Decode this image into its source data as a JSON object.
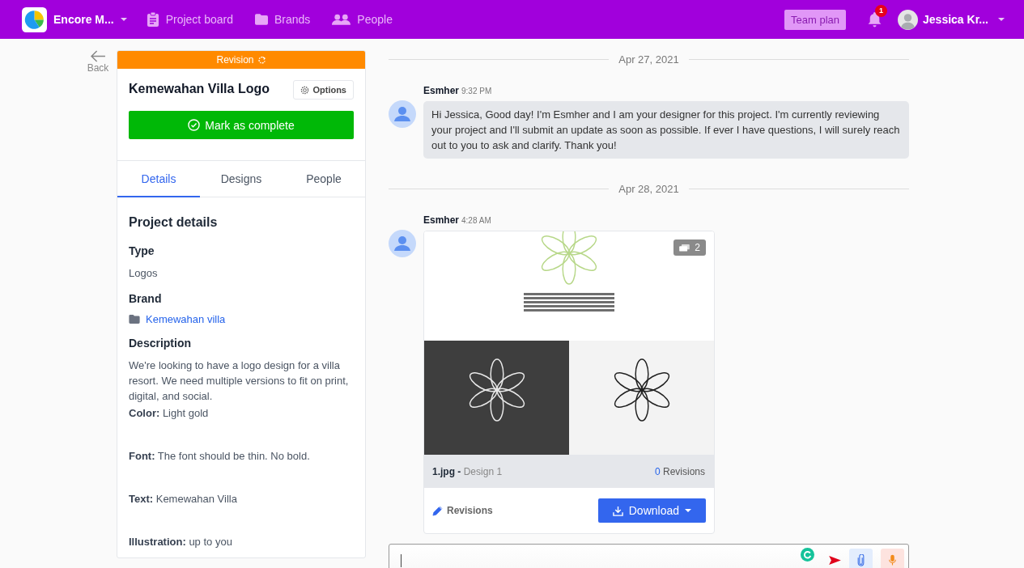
{
  "navbar": {
    "brand": "Encore M...",
    "links": [
      {
        "label": "Project board"
      },
      {
        "label": "Brands"
      },
      {
        "label": "People"
      }
    ],
    "plan": "Team plan",
    "notifications": "1",
    "user": "Jessica Kr..."
  },
  "back": "Back",
  "project": {
    "status": "Revision",
    "title": "Kemewahan Villa Logo",
    "options": "Options",
    "complete": "Mark as complete",
    "tabs": [
      {
        "label": "Details",
        "selected": true
      },
      {
        "label": "Designs",
        "selected": false
      },
      {
        "label": "People",
        "selected": false
      }
    ],
    "heading": "Project details",
    "fields": [
      {
        "kind": "text",
        "label": "Type",
        "value": "Logos"
      },
      {
        "kind": "link",
        "label": "Brand",
        "value": "Kemewahan villa"
      },
      {
        "kind": "text",
        "label": "Description",
        "value": "We're looking to have a logo design for a villa resort. We need multiple versions to fit on print, digital, and social."
      }
    ],
    "notes": [
      "**Color:** Light gold",
      "**Font:** The font should be thin. No bold.",
      "**Text:** Kemewahan Villa",
      "**Illustration:** up to you"
    ]
  },
  "chat": [
    {
      "kind": "date",
      "text": "Apr 27, 2021"
    },
    {
      "kind": "text",
      "author": "Esmher",
      "time": "9:32 PM",
      "text": "Hi Jessica, Good day! I'm Esmher and I am your designer for this project. I'm currently reviewing your project and I'll submit an update as soon as possible. If ever I have questions, I will surely reach out to you to ask and clarify. Thank you!"
    },
    {
      "kind": "date",
      "text": "Apr 28, 2021"
    },
    {
      "kind": "design",
      "author": "Esmher",
      "time": "4:28 AM",
      "count": "2",
      "file": "1.jpg",
      "separator": "-",
      "design": "Design 1",
      "revision_count": "0",
      "revisions_label": "Revisions",
      "revisions_link": "Revisions",
      "download": "Download"
    }
  ]
}
